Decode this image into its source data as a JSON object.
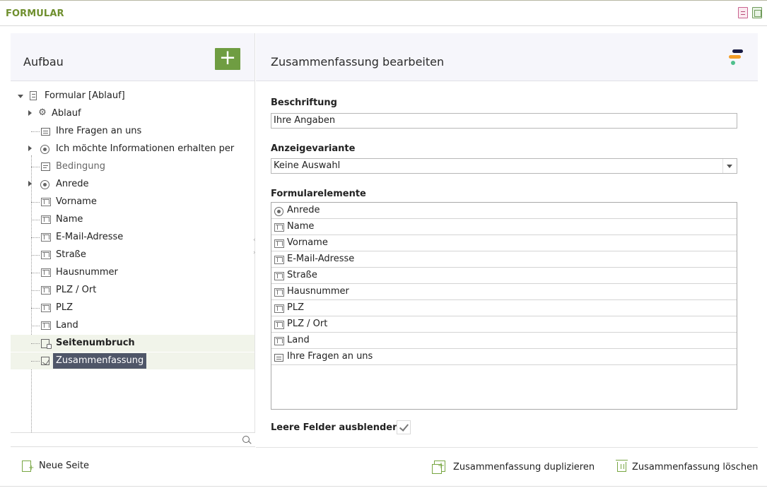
{
  "app": {
    "title": "FORMULAR"
  },
  "top_icons": {
    "document": "document-icon",
    "window": "window-icon"
  },
  "left_panel": {
    "title": "Aufbau",
    "add_label": "+",
    "new_page_label": "Neue Seite",
    "search_icon": "search-icon",
    "tree": [
      {
        "label": "Formular [Ablauf]",
        "icon": "form-icon",
        "expanded": true
      },
      {
        "label": "Ablauf",
        "icon": "gear-icon",
        "expanded": false
      },
      {
        "label": "Ihre Fragen an uns",
        "icon": "lines-icon"
      },
      {
        "label": "Ich möchte Informationen erhalten per",
        "icon": "radio-icon",
        "expanded": false
      },
      {
        "label": "Bedingung",
        "icon": "condition-icon"
      },
      {
        "label": "Anrede",
        "icon": "radio-icon",
        "expanded": false
      },
      {
        "label": "Vorname",
        "icon": "text-field-icon"
      },
      {
        "label": "Name",
        "icon": "text-field-icon"
      },
      {
        "label": "E-Mail-Adresse",
        "icon": "text-field-icon"
      },
      {
        "label": "Straße",
        "icon": "text-field-icon"
      },
      {
        "label": "Hausnummer",
        "icon": "text-field-icon"
      },
      {
        "label": "PLZ / Ort",
        "icon": "text-field-icon"
      },
      {
        "label": "PLZ",
        "icon": "text-field-icon"
      },
      {
        "label": "Land",
        "icon": "text-field-icon"
      },
      {
        "label": "Seitenumbruch",
        "icon": "page-break-icon"
      },
      {
        "label": "Zusammenfassung",
        "icon": "summary-icon",
        "selected": true
      }
    ]
  },
  "right_panel": {
    "title": "Zusammenfassung bearbeiten",
    "caption_label": "Beschriftung",
    "caption_value": "Ihre Angaben",
    "display_variant_label": "Anzeigevariante",
    "display_variant_value": "Keine Auswahl",
    "elements_label": "Formularelemente",
    "elements": [
      {
        "label": "Anrede",
        "icon": "radio-icon"
      },
      {
        "label": "Name",
        "icon": "text-field-icon"
      },
      {
        "label": "Vorname",
        "icon": "text-field-icon"
      },
      {
        "label": "E-Mail-Adresse",
        "icon": "text-field-icon"
      },
      {
        "label": "Straße",
        "icon": "text-field-icon"
      },
      {
        "label": "Hausnummer",
        "icon": "text-field-icon"
      },
      {
        "label": "PLZ",
        "icon": "text-field-icon"
      },
      {
        "label": "PLZ / Ort",
        "icon": "text-field-icon"
      },
      {
        "label": "Land",
        "icon": "text-field-icon"
      },
      {
        "label": "Ihre Fragen an uns",
        "icon": "lines-icon"
      }
    ],
    "hide_empty_label": "Leere Felder ausblenden",
    "hide_empty_checked": true,
    "duplicate_label": "Zusammenfassung duplizieren",
    "delete_label": "Zusammenfassung löschen"
  },
  "colors": {
    "title": "#6f8f2e",
    "accent_green": "#6f9d42",
    "selection": "#4f5668",
    "brand_navy": "#171a43",
    "brand_orange": "#f29d28",
    "brand_green": "#4fc08d"
  }
}
